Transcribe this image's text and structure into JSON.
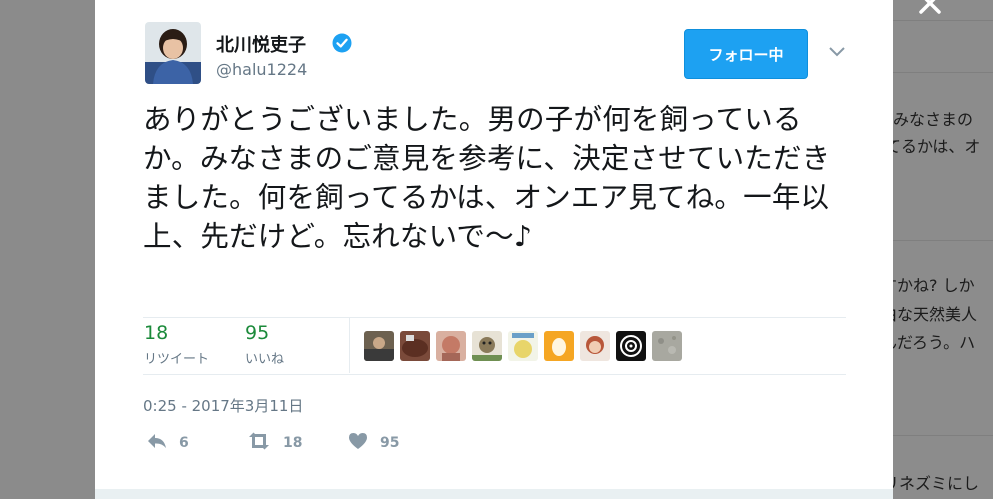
{
  "background": {
    "snippets": [
      "みなさまの",
      "てるかは、オ",
      "すかね? しか",
      "由な天然美人",
      "んだろう。ハ",
      "リネズミにし"
    ]
  },
  "tweet": {
    "author_name": "北川悦吏子",
    "screen_name": "@halu1224",
    "follow_label": "フォロー中",
    "text": "ありがとうございました。男の子が何を飼っているか。みなさまのご意見を参考に、決定させていただきました。何を飼ってるかは、オンエア見てね。一年以上、先だけど。忘れないで〜♪",
    "retweet_count": "18",
    "retweet_label": "リツイート",
    "like_count": "95",
    "like_label": "いいね",
    "timestamp": "0:25 - 2017年3月11日",
    "actions": {
      "reply_count": "6",
      "retweet_count": "18",
      "like_count": "95"
    }
  },
  "colors": {
    "accent": "#1da1f2",
    "retweet_green": "#1b8a3a",
    "muted": "#657786"
  },
  "icons": [
    "verified-icon",
    "chevron-down-icon",
    "reply-icon",
    "retweet-icon",
    "heart-icon",
    "close-icon"
  ]
}
